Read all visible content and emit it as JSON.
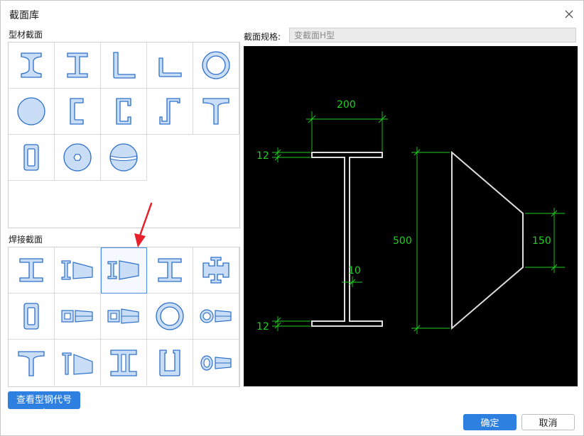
{
  "dialog": {
    "title": "截面库"
  },
  "profiles": {
    "label": "型材截面"
  },
  "welded": {
    "label": "焊接截面"
  },
  "spec": {
    "label": "截面规格:",
    "value": "变截面H型"
  },
  "dimensions": {
    "top_width": "200",
    "top_flange": "12",
    "bottom_flange": "12",
    "height": "500",
    "web": "10",
    "end_height": "150"
  },
  "buttons": {
    "table": "查看型钢代号表",
    "ok": "确定",
    "cancel": "取消"
  },
  "colors": {
    "accent": "#2d7fe0",
    "dimension": "#1fd01f",
    "shape_fill": "#c9ddf7",
    "shape_stroke": "#2b6fc9"
  }
}
